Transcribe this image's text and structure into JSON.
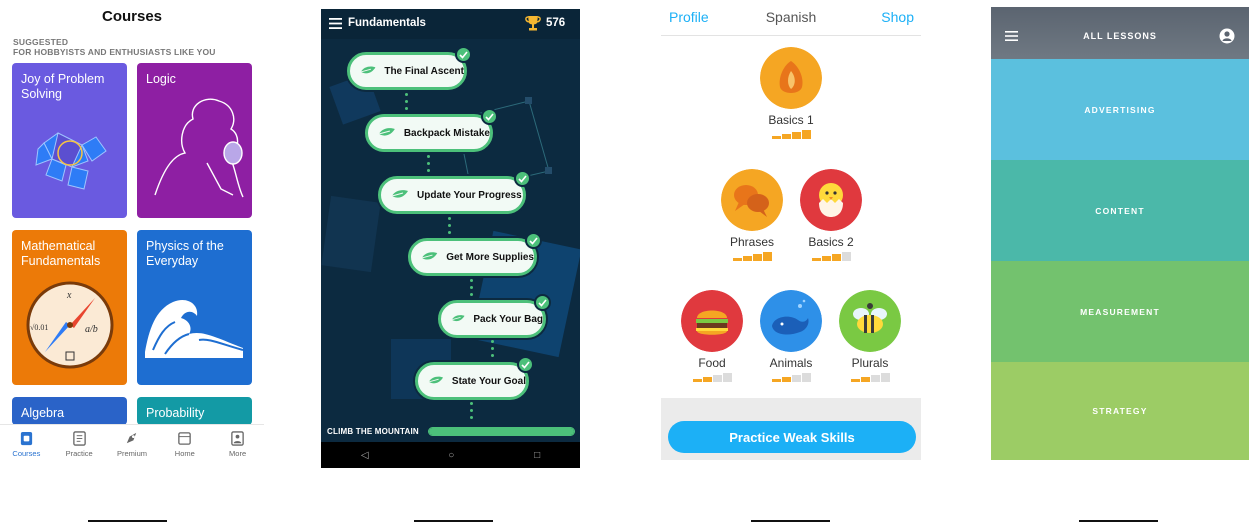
{
  "courses": {
    "title": "Courses",
    "suggested": "SUGGESTED",
    "suggested_sub": "FOR HOBBYISTS AND ENTHUSIASTS LIKE YOU",
    "cards": [
      {
        "title": "Joy of Problem Solving"
      },
      {
        "title": "Logic"
      },
      {
        "title": "Mathematical Fundamentals"
      },
      {
        "title": "Physics of the Everyday"
      },
      {
        "title": "Algebra"
      },
      {
        "title": "Probability"
      }
    ],
    "tabs": [
      {
        "label": "Courses",
        "icon": "courses-icon"
      },
      {
        "label": "Practice",
        "icon": "practice-icon"
      },
      {
        "label": "Premium",
        "icon": "premium-icon"
      },
      {
        "label": "Home",
        "icon": "home-icon"
      },
      {
        "label": "More",
        "icon": "more-icon"
      }
    ],
    "compass": {
      "top": "x",
      "right": "a/b",
      "left": "√0.01"
    }
  },
  "fundamentals": {
    "title": "Fundamentals",
    "score": "576",
    "nodes": [
      {
        "label": "The Final Ascent"
      },
      {
        "label": "Backpack Mistake"
      },
      {
        "label": "Update Your Progress"
      },
      {
        "label": "Get More Supplies"
      },
      {
        "label": "Pack Your Bag"
      },
      {
        "label": "State Your Goal"
      }
    ],
    "progress_label": "CLIMB THE MOUNTAIN",
    "progress": 1.0,
    "nav": [
      "◁",
      "○",
      "□"
    ],
    "accent": "#4CC07A"
  },
  "spanish": {
    "left": "Profile",
    "title": "Spanish",
    "right": "Shop",
    "skills": [
      {
        "label": "Basics 1",
        "color": "#F5A623",
        "level": 3
      },
      {
        "label": "Phrases",
        "color": "#F5A623",
        "level": 3
      },
      {
        "label": "Basics 2",
        "color": "#E0393E",
        "level": 2
      },
      {
        "label": "Food",
        "color": "#E0393E",
        "level": 1
      },
      {
        "label": "Animals",
        "color": "#2E90E8",
        "level": 1
      },
      {
        "label": "Plurals",
        "color": "#7AC943",
        "level": 1
      }
    ],
    "cta": "Practice Weak Skills",
    "accent": "#1CB0F6"
  },
  "lessons": {
    "title": "ALL LESSONS",
    "bands": [
      {
        "label": "ADVERTISING",
        "color": "#5BC0DE"
      },
      {
        "label": "CONTENT",
        "color": "#4BB8A9"
      },
      {
        "label": "MEASUREMENT",
        "color": "#73C26E"
      },
      {
        "label": "STRATEGY",
        "color": "#9CCC65"
      }
    ]
  }
}
